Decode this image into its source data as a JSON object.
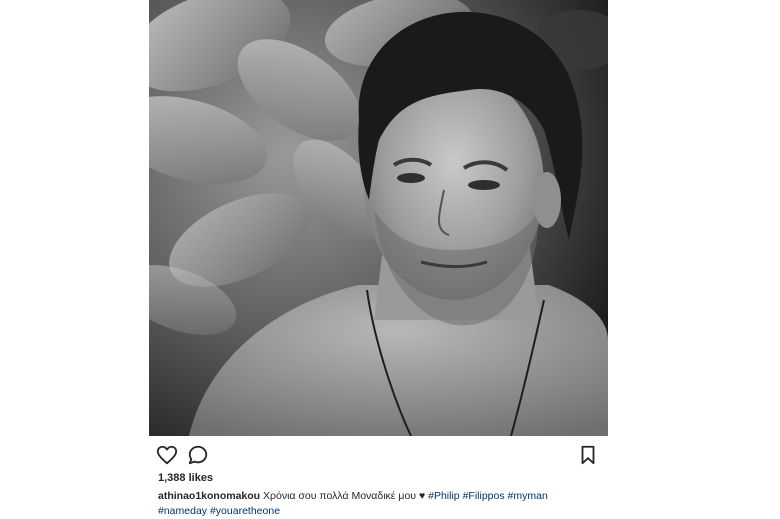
{
  "post": {
    "photo_alt": "",
    "likes": "1,388 likes",
    "caption": {
      "username": "athinao1konomakou",
      "text": "Χρόνια σου πολλά Μοναδικέ μου ♥",
      "hashtags_line1": [
        "#Philip",
        "#Filippos",
        "#myman"
      ],
      "hashtags_line2": [
        "#nameday",
        "#youaretheone"
      ]
    },
    "icons": {
      "like": "heart-outline-icon",
      "comment": "speech-bubble-icon",
      "save": "bookmark-icon"
    },
    "colors": {
      "text": "#262626",
      "hashtag": "#003569",
      "background": "#ffffff"
    }
  }
}
